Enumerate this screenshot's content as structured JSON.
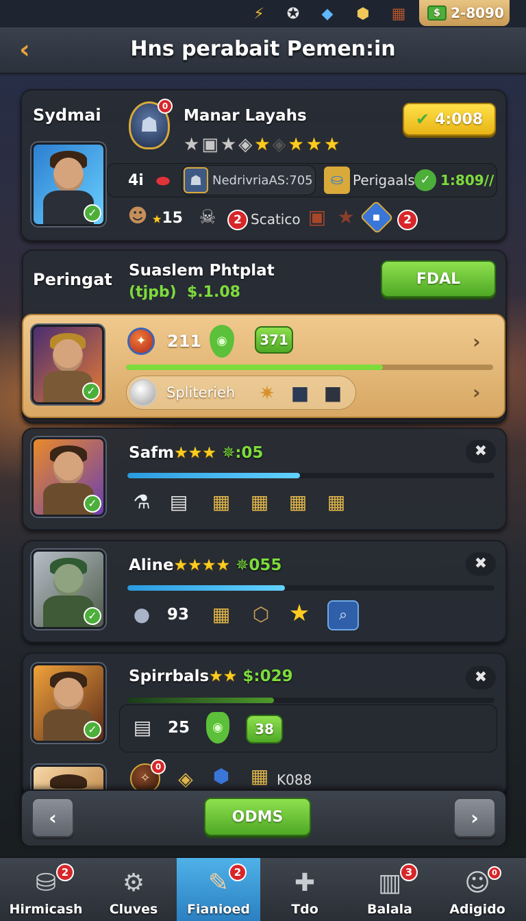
{
  "topbar": {
    "resources": [
      {
        "icon": "lightning-icon",
        "glyph": "⚡",
        "color": "#e7b63a"
      },
      {
        "icon": "chicken-icon",
        "glyph": "🐔",
        "color": "#e6e6e6"
      },
      {
        "icon": "gem-cube-icon",
        "glyph": "◆",
        "color": "#5fb7ff"
      },
      {
        "icon": "medal-icon",
        "glyph": "⬢",
        "color": "#3c6fb5"
      },
      {
        "icon": "crate-icon",
        "glyph": "▦",
        "color": "#b2542c"
      }
    ],
    "currency_value": "2-8090"
  },
  "header": {
    "back_glyph": "‹",
    "title": "Hns perabait Pemen:in"
  },
  "profile": {
    "name": "Sydmai",
    "player_name": "Manar Layahs",
    "rank_badge": "0",
    "score_button": "4:008",
    "stats": {
      "level": "4i",
      "guild": "NedrivriaAS:705",
      "perks_label": "Perigaals",
      "perks_value": "1:809//"
    },
    "count": "15",
    "scatic_badge": "2",
    "scatic_label": "Scatico",
    "end_badge": "2"
  },
  "offer": {
    "title": "Peringat",
    "subtitle": "Suaslem Phtplat",
    "price_label": "(tjpb)",
    "price": "$.1.08",
    "button": "FDAL",
    "item": {
      "value1": "211",
      "value2": "371",
      "progress": 0.7,
      "sub_label": "Spliterieh"
    }
  },
  "heroes": [
    {
      "name": "Safm",
      "stars": 3,
      "reward": "✵:05",
      "progress": 0.47
    },
    {
      "name": "Aline",
      "stars": 4,
      "reward": "✵055",
      "progress": 0.43,
      "count": "93"
    },
    {
      "name": "Spirrbals",
      "stars": 2,
      "reward": "$:029",
      "progress": 0.4,
      "count": "25",
      "btn": "38"
    }
  ],
  "partial_row": {
    "badge": "0",
    "label": "K088"
  },
  "pager": {
    "prev": "‹",
    "button": "ODMS",
    "next": "›"
  },
  "nav": [
    {
      "label": "Hirmicash",
      "icon": "bag-icon",
      "glyph": "⛁",
      "badge": "2"
    },
    {
      "label": "Cluves",
      "icon": "gear-box-icon",
      "glyph": "⚙",
      "badge": ""
    },
    {
      "label": "Fianioed",
      "icon": "scroll-icon",
      "glyph": "✎",
      "badge": "2"
    },
    {
      "label": "Tdo",
      "icon": "puzzle-icon",
      "glyph": "✚",
      "badge": ""
    },
    {
      "label": "Balala",
      "icon": "crate-icon",
      "glyph": "▥",
      "badge": "3"
    },
    {
      "label": "Adigido",
      "icon": "robot-icon",
      "glyph": "☺",
      "badge": "0"
    }
  ]
}
